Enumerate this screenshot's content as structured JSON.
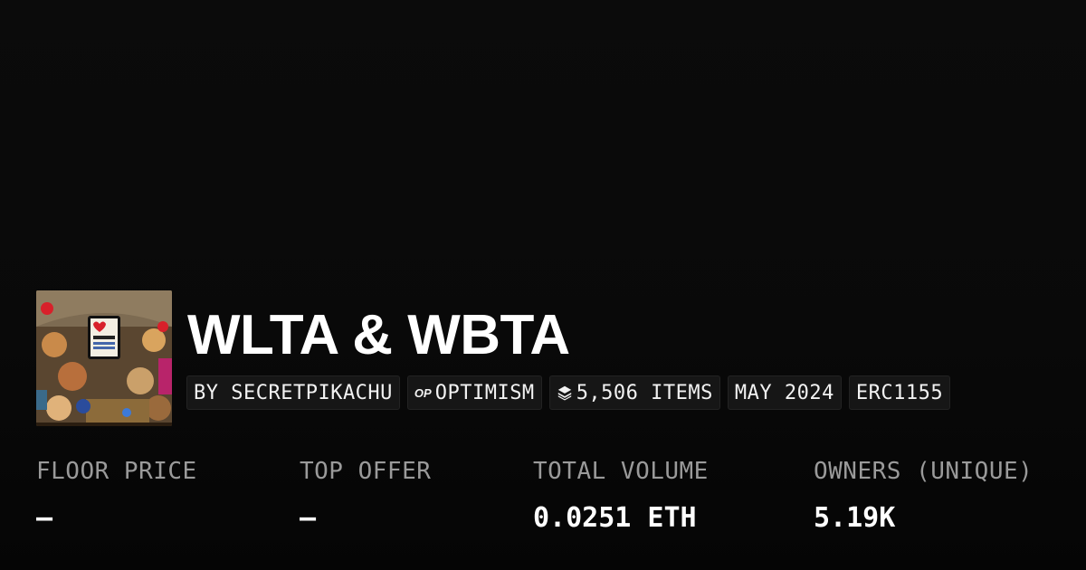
{
  "collection": {
    "title": "WLTA & WBTA",
    "creator": "BY SECRETPIKACHU",
    "chain_icon": "op-logo-icon",
    "chain": "OPTIMISM",
    "items_icon": "layers-icon",
    "items": "5,506 ITEMS",
    "date": "MAY 2024",
    "standard": "ERC1155",
    "thumbnail": "collection-artwork-image"
  },
  "stats": [
    {
      "label": "FLOOR PRICE",
      "value": "—"
    },
    {
      "label": "TOP OFFER",
      "value": "—"
    },
    {
      "label": "TOTAL VOLUME",
      "value": "0.0251 ETH"
    },
    {
      "label": "OWNERS (UNIQUE)",
      "value": "5.19K"
    }
  ],
  "colors": {
    "background": "#0a0a0a",
    "chip_background": "#161616",
    "label": "#9a9a9a",
    "text": "#ffffff"
  }
}
